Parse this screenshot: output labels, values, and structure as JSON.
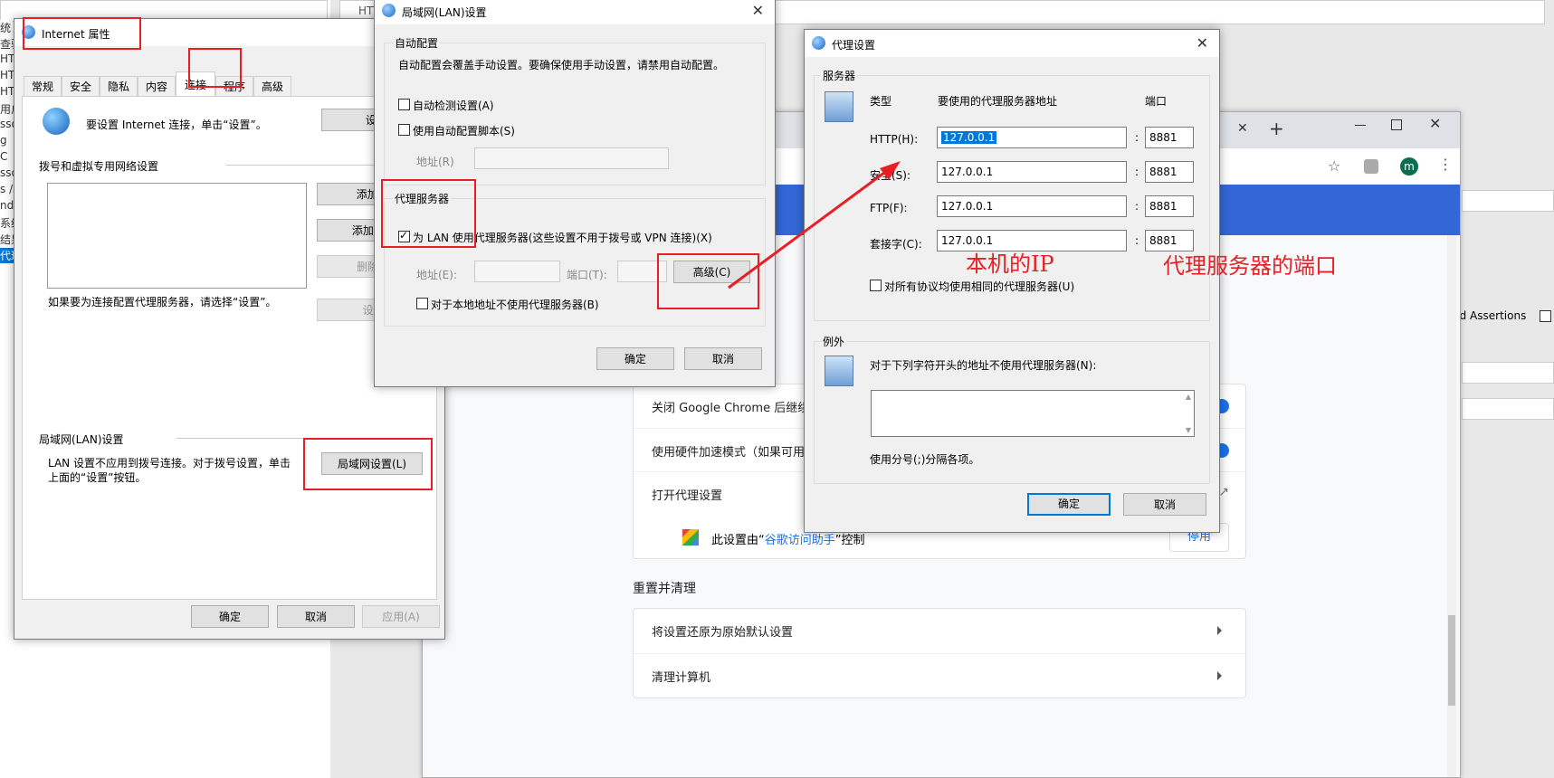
{
  "background": {
    "left_list": [
      "统",
      "查验",
      "HTT",
      "HTT",
      "HTT",
      "用户",
      "sso",
      "g",
      "C",
      "sso",
      "s /s",
      "nd",
      "系统",
      "结果",
      "代理"
    ],
    "right_partial_text": "dd Assertions",
    "top_text": "HTT"
  },
  "chrome": {
    "tab_close": "✕",
    "tab_new": "+",
    "avatar_letter": "m",
    "rows": [
      {
        "label": "关闭 Google Chrome 后继续运行"
      },
      {
        "label": "使用硬件加速模式（如果可用"
      },
      {
        "label": "打开代理设置"
      }
    ],
    "controlled_by_prefix": "此设置由“",
    "controlled_by_link": "谷歌访问助手",
    "controlled_by_suffix": "”控制",
    "disable_button": "停用",
    "section_reset": "重置并清理",
    "reset_rows": [
      {
        "label": "将设置还原为原始默认设置"
      },
      {
        "label": "清理计算机"
      }
    ]
  },
  "internet_props": {
    "title": "Internet 属性",
    "tabs": [
      "常规",
      "安全",
      "隐私",
      "内容",
      "连接",
      "程序",
      "高级"
    ],
    "active_tab": "连接",
    "setup_text": "要设置 Internet 连接，单击“设置”。",
    "setup_button": "设置(U)",
    "dialup_header": "拨号和虚拟专用网络设置",
    "add_button": "添加(D)",
    "add_vpn_button": "添加 VPN",
    "delete_button": "删除(R)",
    "settings_button": "设置(",
    "proxy_hint": "如果要为连接配置代理服务器，请选择“设置”。",
    "lan_header": "局域网(LAN)设置",
    "lan_text_1": "LAN 设置不应用到拨号连接。对于拨号设置，单击",
    "lan_text_2": "上面的“设置”按钮。",
    "lan_button": "局域网设置(L)",
    "ok": "确定",
    "cancel": "取消",
    "apply": "应用(A)"
  },
  "lan_dialog": {
    "title": "局域网(LAN)设置",
    "auto_group": "自动配置",
    "auto_desc": "自动配置会覆盖手动设置。要确保使用手动设置，请禁用自动配置。",
    "auto_detect": "自动检测设置(A)",
    "auto_script": "使用自动配置脚本(S)",
    "address_label": "地址(R)",
    "proxy_group": "代理服务器",
    "use_proxy": "为 LAN 使用代理服务器(这些设置不用于拨号或 VPN 连接)(X)",
    "addr_label": "地址(E):",
    "port_label": "端口(T):",
    "advanced_button": "高级(C)",
    "bypass_local": "对于本地地址不使用代理服务器(B)",
    "ok": "确定",
    "cancel": "取消"
  },
  "proxy_settings": {
    "title": "代理设置",
    "servers_group": "服务器",
    "col_type": "类型",
    "col_address": "要使用的代理服务器地址",
    "col_port": "端口",
    "rows": [
      {
        "type": "HTTP(H):",
        "address": "127.0.0.1",
        "port": "8881"
      },
      {
        "type": "安全(S):",
        "address": "127.0.0.1",
        "port": "8881"
      },
      {
        "type": "FTP(F):",
        "address": "127.0.0.1",
        "port": "8881"
      },
      {
        "type": "套接字(C):",
        "address": "127.0.0.1",
        "port": "8881"
      }
    ],
    "colon": ":",
    "same_for_all": "对所有协议均使用相同的代理服务器(U)",
    "exceptions_group": "例外",
    "exceptions_desc": "对于下列字符开头的地址不使用代理服务器(N):",
    "exceptions_hint": "使用分号(;)分隔各项。",
    "ok": "确定",
    "cancel": "取消"
  },
  "annotations": {
    "local_ip": "本机的IP",
    "proxy_port": "代理服务器的端口"
  },
  "colors": {
    "annotation_red": "#e81e25",
    "chrome_blue": "#3367d6",
    "selection_blue": "#0078d7"
  }
}
